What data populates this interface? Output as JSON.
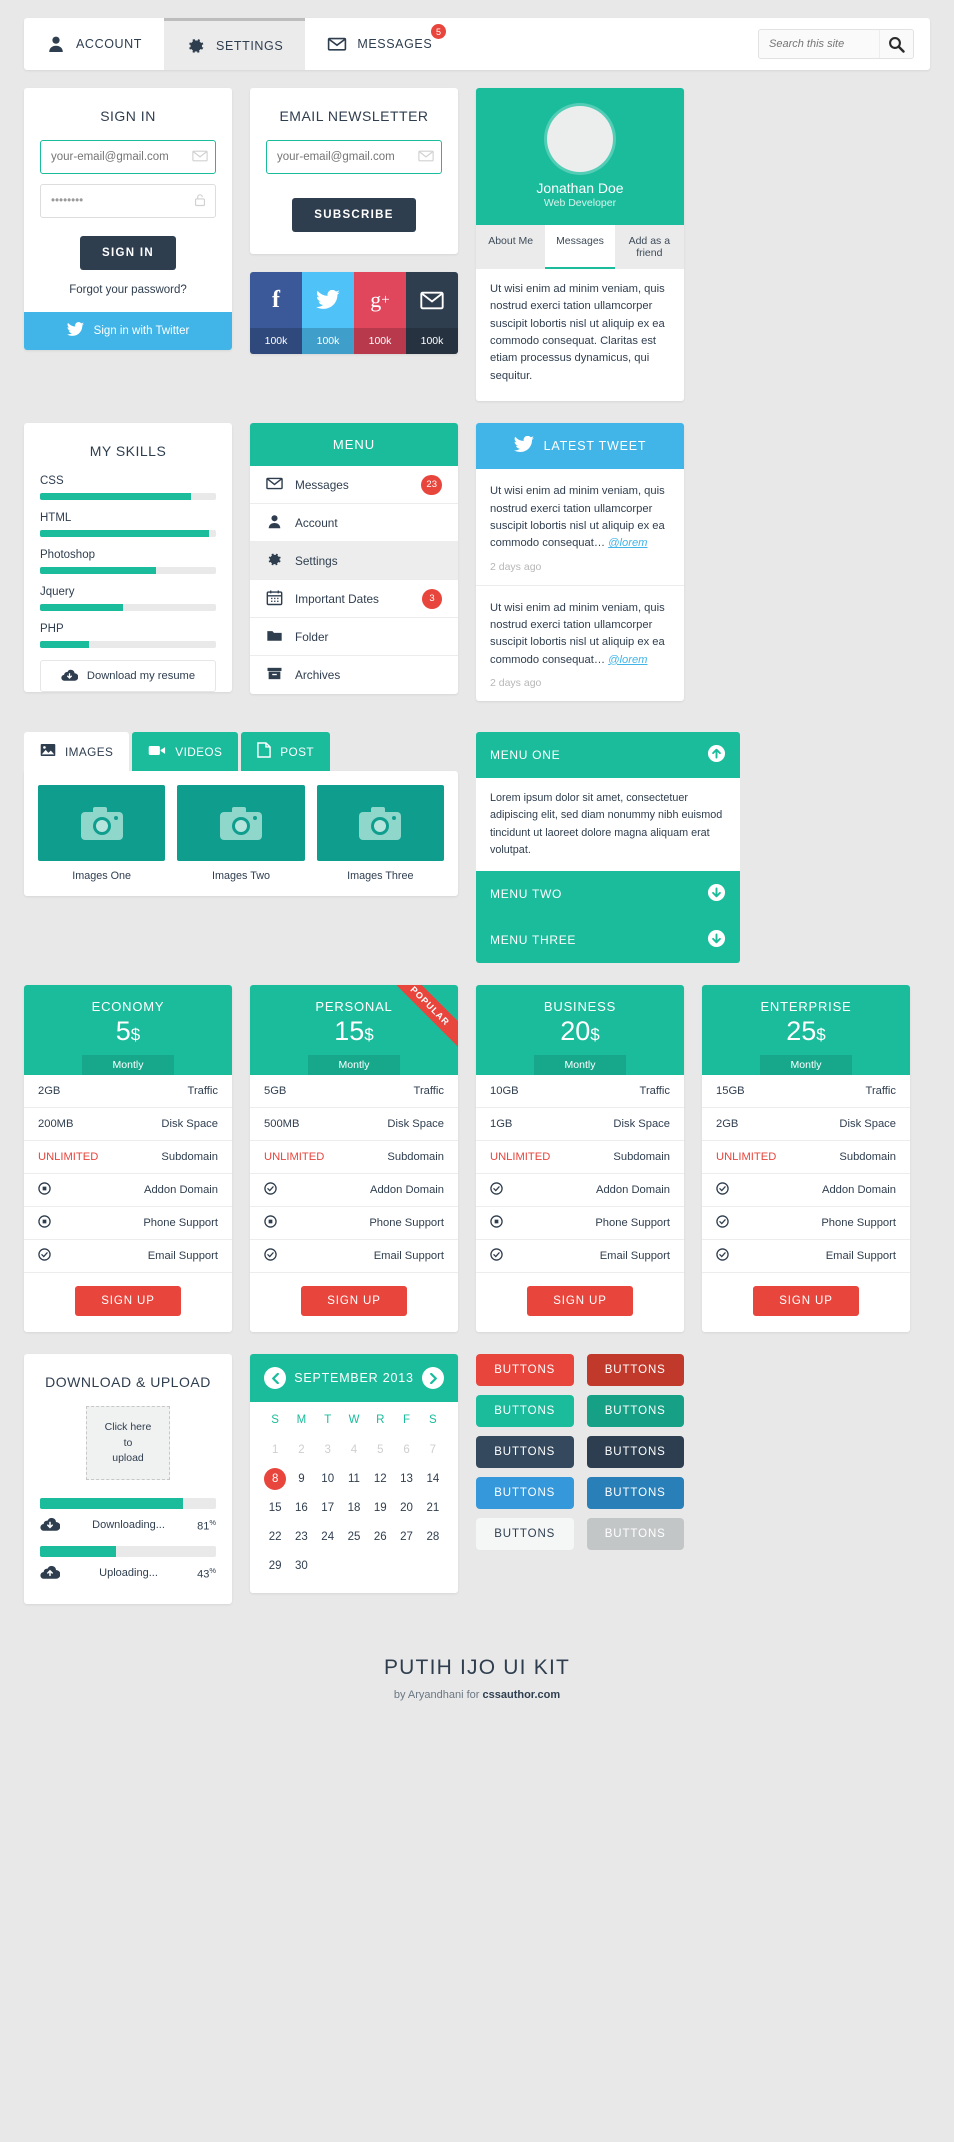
{
  "nav": {
    "tabs": [
      {
        "label": "ACCOUNT",
        "icon": "user-icon",
        "active": false,
        "badge": null
      },
      {
        "label": "SETTINGS",
        "icon": "gear-icon",
        "active": true,
        "badge": null
      },
      {
        "label": "MESSAGES",
        "icon": "envelope-icon",
        "active": false,
        "badge": "5"
      }
    ],
    "search": {
      "placeholder": "Search this site",
      "value": "",
      "icon": "search-icon"
    }
  },
  "signin": {
    "title": "SIGN IN",
    "email_placeholder": "your-email@gmail.com",
    "email_value": "",
    "password_value": "••••••••",
    "submit_label": "SIGN IN",
    "forgot_label": "Forgot your password?",
    "twitter_label": "Sign in with Twitter",
    "twitter_color": "#41b5e8"
  },
  "newsletter": {
    "title": "EMAIL NEWSLETTER",
    "email_placeholder": "your-email@gmail.com",
    "email_value": "",
    "submit_label": "SUBSCRIBE"
  },
  "social": [
    {
      "name": "facebook",
      "glyph": "f",
      "count": "100k",
      "color": "#3b5998"
    },
    {
      "name": "twitter",
      "glyph": "twitter-icon",
      "count": "100k",
      "color": "#4fc3f7"
    },
    {
      "name": "googleplus",
      "glyph": "g+",
      "count": "100k",
      "color": "#e0465c"
    },
    {
      "name": "email",
      "glyph": "envelope-icon",
      "count": "100k",
      "color": "#2f3e4f"
    }
  ],
  "profile": {
    "name": "Jonathan Doe",
    "role": "Web Developer",
    "tabs": [
      {
        "label": "About Me",
        "active": false
      },
      {
        "label": "Messages",
        "active": true
      },
      {
        "label": "Add as a friend",
        "active": false
      }
    ],
    "text": "Ut wisi enim ad minim veniam, quis nostrud exerci tation ullamcorper suscipit lobortis nisl ut aliquip ex ea commodo consequat. Claritas est etiam processus dynamicus, qui sequitur.",
    "accent": "#1abc9c"
  },
  "skills": {
    "title": "MY SKILLS",
    "items": [
      {
        "label": "CSS",
        "value": 86
      },
      {
        "label": "HTML",
        "value": 96
      },
      {
        "label": "Photoshop",
        "value": 66
      },
      {
        "label": "Jquery",
        "value": 47
      },
      {
        "label": "PHP",
        "value": 28
      }
    ],
    "resume_label": "Download my resume"
  },
  "menu": {
    "title": "MENU",
    "items": [
      {
        "label": "Messages",
        "icon": "envelope-icon",
        "badge": "23",
        "active": false
      },
      {
        "label": "Account",
        "icon": "user-icon",
        "badge": null,
        "active": false
      },
      {
        "label": "Settings",
        "icon": "gear-icon",
        "badge": null,
        "active": true
      },
      {
        "label": "Important Dates",
        "icon": "calendar-icon",
        "badge": "3",
        "active": false
      },
      {
        "label": "Folder",
        "icon": "folder-icon",
        "badge": null,
        "active": false
      },
      {
        "label": "Archives",
        "icon": "archive-icon",
        "badge": null,
        "active": false
      }
    ]
  },
  "tweets": {
    "title": "LATEST TWEET",
    "items": [
      {
        "text": "Ut wisi enim ad minim veniam, quis nostrud exerci tation ullamcorper suscipit lobortis nisl ut aliquip ex ea commodo consequat…",
        "handle": "@lorem",
        "ago": "2 days ago"
      },
      {
        "text": "Ut wisi enim ad minim veniam, quis nostrud exerci tation ullamcorper suscipit lobortis nisl ut aliquip ex ea commodo consequat…",
        "handle": "@lorem",
        "ago": "2 days ago"
      }
    ]
  },
  "gallery": {
    "tabs": [
      {
        "label": "IMAGES",
        "icon": "image-icon",
        "active": true
      },
      {
        "label": "VIDEOS",
        "icon": "video-icon",
        "active": false
      },
      {
        "label": "POST",
        "icon": "document-icon",
        "active": false
      }
    ],
    "items": [
      {
        "caption": "Images One",
        "icon": "camera-icon"
      },
      {
        "caption": "Images Two",
        "icon": "camera-icon"
      },
      {
        "caption": "Images Three",
        "icon": "camera-icon"
      }
    ]
  },
  "accordion": [
    {
      "label": "MENU ONE",
      "state": "open",
      "icon": "arrow-up-circle-icon",
      "body": "Lorem ipsum dolor sit amet, consectetuer adipiscing elit, sed diam nonummy nibh euismod tincidunt ut laoreet dolore magna aliquam erat volutpat."
    },
    {
      "label": "MENU TWO",
      "state": "closed",
      "icon": "arrow-down-circle-icon",
      "body": ""
    },
    {
      "label": "MENU THREE",
      "state": "closed",
      "icon": "arrow-down-circle-icon",
      "body": ""
    }
  ],
  "pricing": {
    "feature_labels": [
      "Traffic",
      "Disk Space",
      "Subdomain",
      "Addon Domain",
      "Phone Support",
      "Email Support"
    ],
    "period": "Montly",
    "signup_label": "SIGN UP",
    "popular_label": "POPULAR",
    "plans": [
      {
        "name": "ECONOMY",
        "price": "5",
        "currency": "$",
        "popular": false,
        "values": [
          "2GB",
          "200MB",
          "UNLIMITED",
          "dot-circle-icon",
          "dot-circle-icon",
          "check-circle-icon"
        ]
      },
      {
        "name": "PERSONAL",
        "price": "15",
        "currency": "$",
        "popular": true,
        "values": [
          "5GB",
          "500MB",
          "UNLIMITED",
          "check-circle-icon",
          "dot-circle-icon",
          "check-circle-icon"
        ]
      },
      {
        "name": "BUSINESS",
        "price": "20",
        "currency": "$",
        "popular": false,
        "values": [
          "10GB",
          "1GB",
          "UNLIMITED",
          "check-circle-icon",
          "dot-circle-icon",
          "check-circle-icon"
        ]
      },
      {
        "name": "ENTERPRISE",
        "price": "25",
        "currency": "$",
        "popular": false,
        "values": [
          "15GB",
          "2GB",
          "UNLIMITED",
          "check-circle-icon",
          "check-circle-icon",
          "check-circle-icon"
        ]
      }
    ]
  },
  "transfer": {
    "title": "DOWNLOAD & UPLOAD",
    "upload_lines": [
      "Click here",
      "to",
      "upload"
    ],
    "bars": [
      {
        "label": "Downloading...",
        "value": 81,
        "unit": "%",
        "icon": "cloud-download-icon"
      },
      {
        "label": "Uploading...",
        "value": 43,
        "unit": "%",
        "icon": "cloud-upload-icon"
      }
    ]
  },
  "calendar": {
    "title": "SEPTEMBER 2013",
    "prev_icon": "chevron-left-circle-icon",
    "next_icon": "chevron-right-circle-icon",
    "dow": [
      "S",
      "M",
      "T",
      "W",
      "R",
      "F",
      "S"
    ],
    "muted_days": [
      1,
      2,
      3,
      4,
      5,
      6,
      7
    ],
    "days": [
      1,
      2,
      3,
      4,
      5,
      6,
      7,
      8,
      9,
      10,
      11,
      12,
      13,
      14,
      15,
      16,
      17,
      18,
      19,
      20,
      21,
      22,
      23,
      24,
      25,
      26,
      27,
      28,
      29,
      30
    ],
    "today": 8
  },
  "buttons": {
    "label": "BUTTONS",
    "swatches": [
      {
        "light": "#e8453c",
        "dark": "#c0392b",
        "text_light": "#ffffff",
        "text_dark": "#ffffff"
      },
      {
        "light": "#1abc9c",
        "dark": "#16a085",
        "text_light": "#ffffff",
        "text_dark": "#ffffff"
      },
      {
        "light": "#34495e",
        "dark": "#2c3e50",
        "text_light": "#ffffff",
        "text_dark": "#ffffff"
      },
      {
        "light": "#3498db",
        "dark": "#2980b9",
        "text_light": "#ffffff",
        "text_dark": "#ffffff"
      },
      {
        "light": "#f5f7f7",
        "dark": "#c3c6c7",
        "text_light": "#2f3e4f",
        "text_dark": "#ffffff"
      }
    ]
  },
  "footer": {
    "title": "PUTIH IJO UI KIT",
    "by_prefix": "by Aryandhani  for ",
    "credit": "cssauthor.com"
  }
}
